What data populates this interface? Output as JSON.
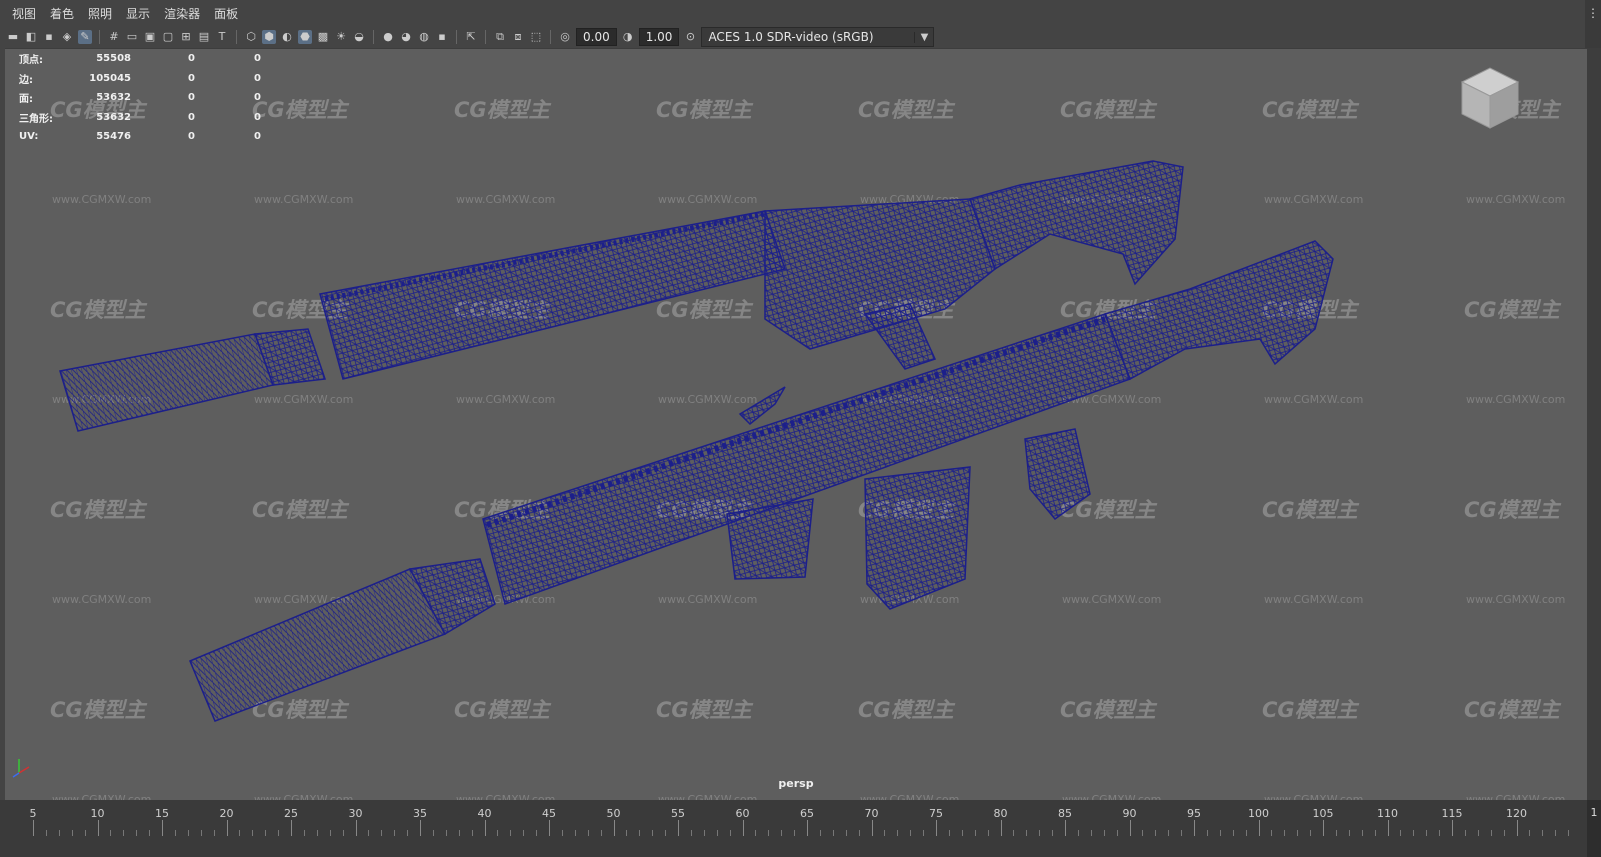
{
  "menu": [
    "视图",
    "着色",
    "照明",
    "显示",
    "渲染器",
    "面板"
  ],
  "toolbar": {
    "exposure": "0.00",
    "gamma": "1.00",
    "color_management": "ACES 1.0 SDR-video (sRGB)"
  },
  "stats": [
    {
      "label": "顶点:",
      "v1": "55508",
      "v2": "0",
      "v3": "0"
    },
    {
      "label": "边:",
      "v1": "105045",
      "v2": "0",
      "v3": "0"
    },
    {
      "label": "面:",
      "v1": "53632",
      "v2": "0",
      "v3": "0"
    },
    {
      "label": "三角形:",
      "v1": "53632",
      "v2": "0",
      "v3": "0"
    },
    {
      "label": "UV:",
      "v1": "55476",
      "v2": "0",
      "v3": "0"
    }
  ],
  "camera": "persp",
  "watermark": {
    "logo": "CG模型主",
    "url": "www.CGMXW.com"
  },
  "timeline": {
    "labels": [
      "5",
      "10",
      "15",
      "20",
      "25",
      "30",
      "35",
      "40",
      "45",
      "50",
      "55",
      "60",
      "65",
      "70",
      "75",
      "80",
      "85",
      "90",
      "95",
      "100",
      "105",
      "110",
      "115",
      "120"
    ],
    "end": "1"
  },
  "colors": {
    "wire": "#1c1f8a",
    "viewport_bg": "#5e5e5e"
  }
}
